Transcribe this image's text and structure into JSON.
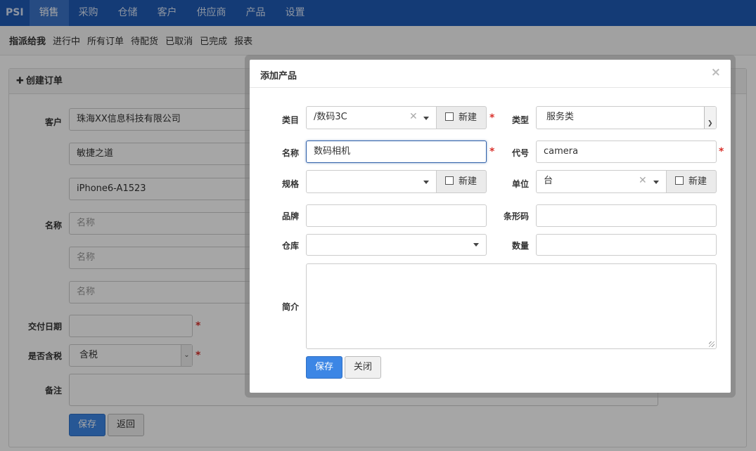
{
  "topnav": {
    "brand": "PSI",
    "items": [
      "销售",
      "采购",
      "仓储",
      "客户",
      "供应商",
      "产品",
      "设置"
    ],
    "active_index": 0
  },
  "subnav": {
    "items": [
      "指派给我",
      "进行中",
      "所有订单",
      "待配货",
      "已取消",
      "已完成",
      "报表"
    ],
    "active_index": 0
  },
  "order_panel": {
    "title": "创建订单",
    "customer_label": "客户",
    "customer_values": [
      "珠海XX信息科技有限公司",
      "敏捷之道",
      "iPhone6-A1523"
    ],
    "name_label": "名称",
    "name_placeholder": "名称",
    "delivery_label": "交付日期",
    "tax_label": "是否含税",
    "tax_value": "含税",
    "remark_label": "备注",
    "save_label": "保存",
    "back_label": "返回",
    "required_mark": "*"
  },
  "modal": {
    "title": "添加产品",
    "close_glyph": "×",
    "required_mark": "*",
    "category_label": "类目",
    "category_value": "/数码3C",
    "new_label": "新建",
    "type_label": "类型",
    "type_value": "服务类",
    "name_label": "名称",
    "name_value": "数码相机",
    "code_label": "代号",
    "code_value": "camera",
    "spec_label": "规格",
    "spec_value": "",
    "unit_label": "单位",
    "unit_value": "台",
    "brand_label": "品牌",
    "brand_value": "",
    "barcode_label": "条形码",
    "barcode_value": "",
    "warehouse_label": "仓库",
    "warehouse_value": "",
    "quantity_label": "数量",
    "quantity_value": "",
    "intro_label": "简介",
    "intro_value": "",
    "save_label": "保存",
    "close_label": "关闭"
  }
}
